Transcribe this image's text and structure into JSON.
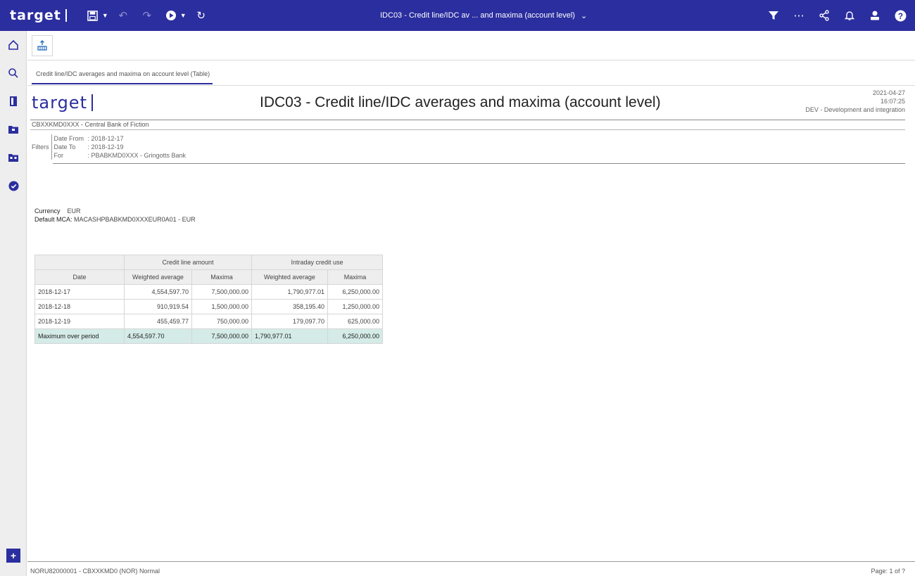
{
  "app": {
    "brand": "target",
    "doc_title": "IDC03 - Credit line/IDC av ... and maxima (account level)"
  },
  "toolbar_icons": [
    "save-icon",
    "undo-icon",
    "redo-icon",
    "run-icon",
    "refresh-icon"
  ],
  "right_icons": [
    "filter-icon",
    "more-icon",
    "share-icon",
    "bell-icon",
    "user-icon",
    "help-icon"
  ],
  "tab": {
    "label": "Credit line/IDC averages and maxima on account level (Table)"
  },
  "report": {
    "logo": "target",
    "title": "IDC03 - Credit line/IDC averages and maxima  (account level)",
    "date": "2021-04-27",
    "time": "16:07:25",
    "environment": "DEV - Development and integration",
    "bank": "CBXXKMD0XXX - Central Bank of Fiction",
    "filters_label": "Filters",
    "filters": [
      {
        "key": "Date From",
        "value": ": 2018-12-17"
      },
      {
        "key": "Date To",
        "value": ": 2018-12-19"
      },
      {
        "key": "For",
        "value": ": PBABKMD0XXX - Gringotts Bank"
      }
    ],
    "currency_label": "Currency",
    "currency_value": "EUR",
    "mca_label": "Default MCA:",
    "mca_value": "MACASHPBABKMD0XXXEUR0A01 - EUR"
  },
  "table": {
    "group_headers": [
      "Credit line amount",
      "Intraday credit use"
    ],
    "columns": [
      "Date",
      "Weighted average",
      "Maxima",
      "Weighted average",
      "Maxima"
    ],
    "rows": [
      [
        "2018-12-17",
        "4,554,597.70",
        "7,500,000.00",
        "1,790,977.01",
        "6,250,000.00"
      ],
      [
        "2018-12-18",
        "910,919.54",
        "1,500,000.00",
        "358,195.40",
        "1,250,000.00"
      ],
      [
        "2018-12-19",
        "455,459.77",
        "750,000.00",
        "179,097.70",
        "625,000.00"
      ]
    ],
    "max_row": [
      "Maximum over period",
      "4,554,597.70",
      "7,500,000.00",
      "1,790,977.01",
      "6,250,000.00"
    ]
  },
  "footer": {
    "left": "NORU82000001 - CBXXKMD0 (NOR) Normal",
    "right": "Page:  1 of ?"
  },
  "colors": {
    "brand": "#2b2e9e",
    "max_row_bg": "#d4ebe7"
  }
}
